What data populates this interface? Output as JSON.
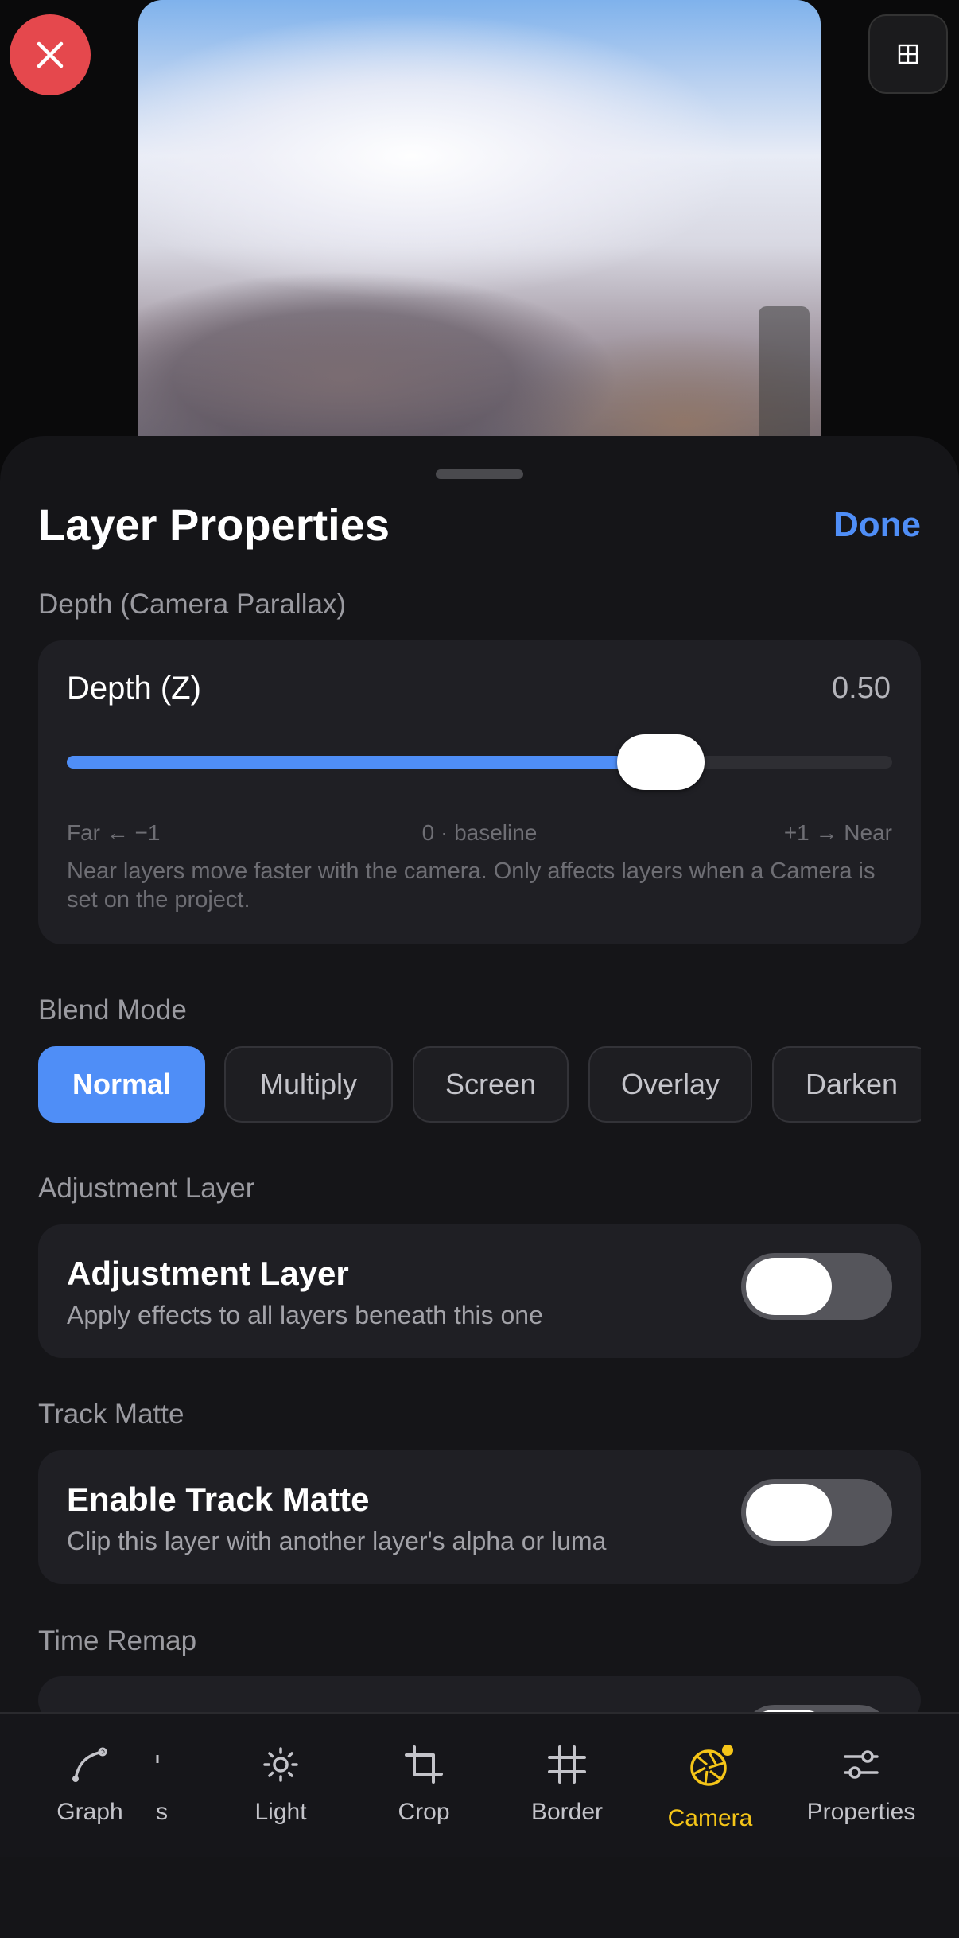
{
  "header": {
    "title": "Layer Properties",
    "done_label": "Done"
  },
  "depth": {
    "section_label": "Depth (Camera Parallax)",
    "label": "Depth (Z)",
    "value_text": "0.50",
    "slider_value": 0.5,
    "slider_fraction": 0.72,
    "tick_far": "Far ← −1",
    "tick_mid": "0 · baseline",
    "tick_near": "+1 → Near",
    "hint": "Near layers move faster with the camera. Only affects layers when a Camera is set on the project."
  },
  "blend": {
    "section_label": "Blend Mode",
    "options": [
      "Normal",
      "Multiply",
      "Screen",
      "Overlay",
      "Darken"
    ],
    "selected": "Normal"
  },
  "adjustment": {
    "section_label": "Adjustment Layer",
    "title": "Adjustment Layer",
    "subtitle": "Apply effects to all layers beneath this one",
    "enabled": false
  },
  "track_matte": {
    "section_label": "Track Matte",
    "title": "Enable Track Matte",
    "subtitle": "Clip this layer with another layer's alpha or luma",
    "enabled": false
  },
  "time_remap": {
    "section_label": "Time Remap"
  },
  "tabs": [
    {
      "label": "Graph",
      "icon": "graph-curve-icon"
    },
    {
      "label": "s",
      "icon": "clipped-icon"
    },
    {
      "label": "Light",
      "icon": "sun-icon"
    },
    {
      "label": "Crop",
      "icon": "crop-icon"
    },
    {
      "label": "Border",
      "icon": "grid-hash-icon"
    },
    {
      "label": "Camera",
      "icon": "aperture-icon",
      "active": true
    },
    {
      "label": "Properties",
      "icon": "sliders-icon"
    }
  ],
  "colors": {
    "accent": "#4f8ef7",
    "active_tab": "#f5c518",
    "close": "#e5484d",
    "sheet": "#151518",
    "card": "#1f1f24"
  }
}
